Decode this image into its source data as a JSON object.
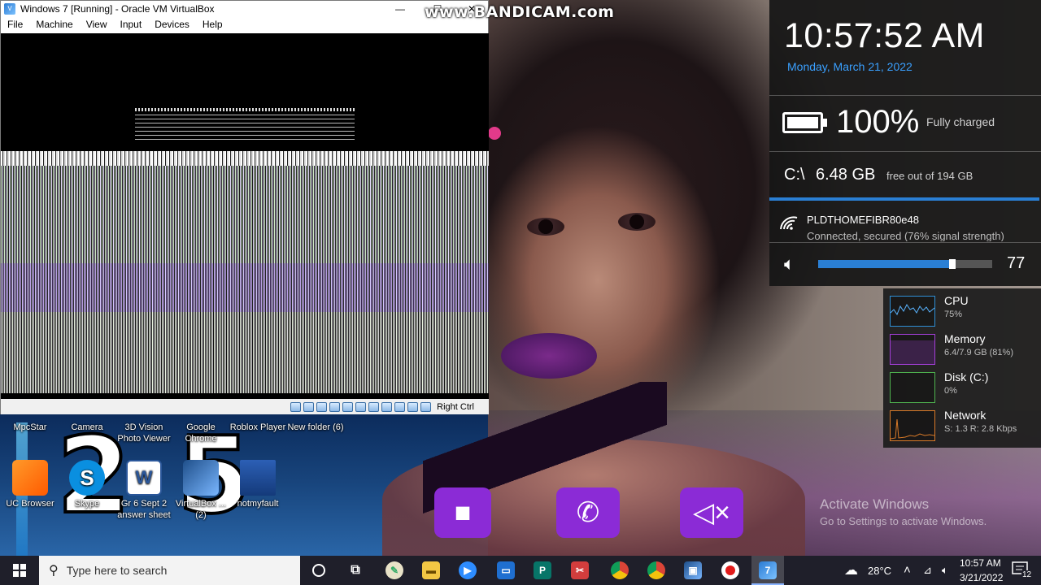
{
  "watermark": "www.BANDICAM.com",
  "vbox": {
    "title": "Windows 7 [Running] - Oracle VM VirtualBox",
    "menu": [
      "File",
      "Machine",
      "View",
      "Input",
      "Devices",
      "Help"
    ],
    "host_key": "Right Ctrl"
  },
  "desktop_icons": [
    {
      "label": "MpcStar"
    },
    {
      "label": "Camera"
    },
    {
      "label": "3D Vision Photo Viewer"
    },
    {
      "label": "Google Chrome"
    },
    {
      "label": "Roblox Player"
    },
    {
      "label": "New folder (6)"
    },
    {
      "label": "UC Browser"
    },
    {
      "label": "Skype"
    },
    {
      "label": "Gr 6 Sept 2 answer sheet"
    },
    {
      "label": "VirtualBox ... (2)"
    },
    {
      "label": "notmyfault"
    }
  ],
  "wallpaper_digits": [
    "2",
    "5"
  ],
  "activate": {
    "title": "Activate Windows",
    "subtitle": "Go to Settings to activate Windows."
  },
  "widgets": {
    "time": "10:57:52 AM",
    "date": "Monday, March 21, 2022",
    "battery": {
      "percent": "100%",
      "status": "Fully charged",
      "level": 1.0
    },
    "drive": {
      "label": "C:\\",
      "free": "6.48 GB",
      "total": "free out of 194 GB"
    },
    "wifi": {
      "ssid": "PLDTHOMEFIBR80e48",
      "status": "Connected, secured (76% signal strength)"
    },
    "volume": {
      "value": "77",
      "level": 0.77
    }
  },
  "performance": [
    {
      "name": "CPU",
      "value": "75%",
      "color": "#2f8fd6"
    },
    {
      "name": "Memory",
      "value": "6.4/7.9 GB (81%)",
      "color": "#a43fd8"
    },
    {
      "name": "Disk (C:)",
      "value": "0%",
      "color": "#4fb34f"
    },
    {
      "name": "Network",
      "value": "S: 1.3  R: 2.8 Kbps",
      "color": "#d97a28"
    }
  ],
  "taskbar": {
    "search_placeholder": "Type here to search",
    "temperature": "28°C",
    "clock_time": "10:57 AM",
    "clock_date": "3/21/2022",
    "notification_count": "12"
  }
}
